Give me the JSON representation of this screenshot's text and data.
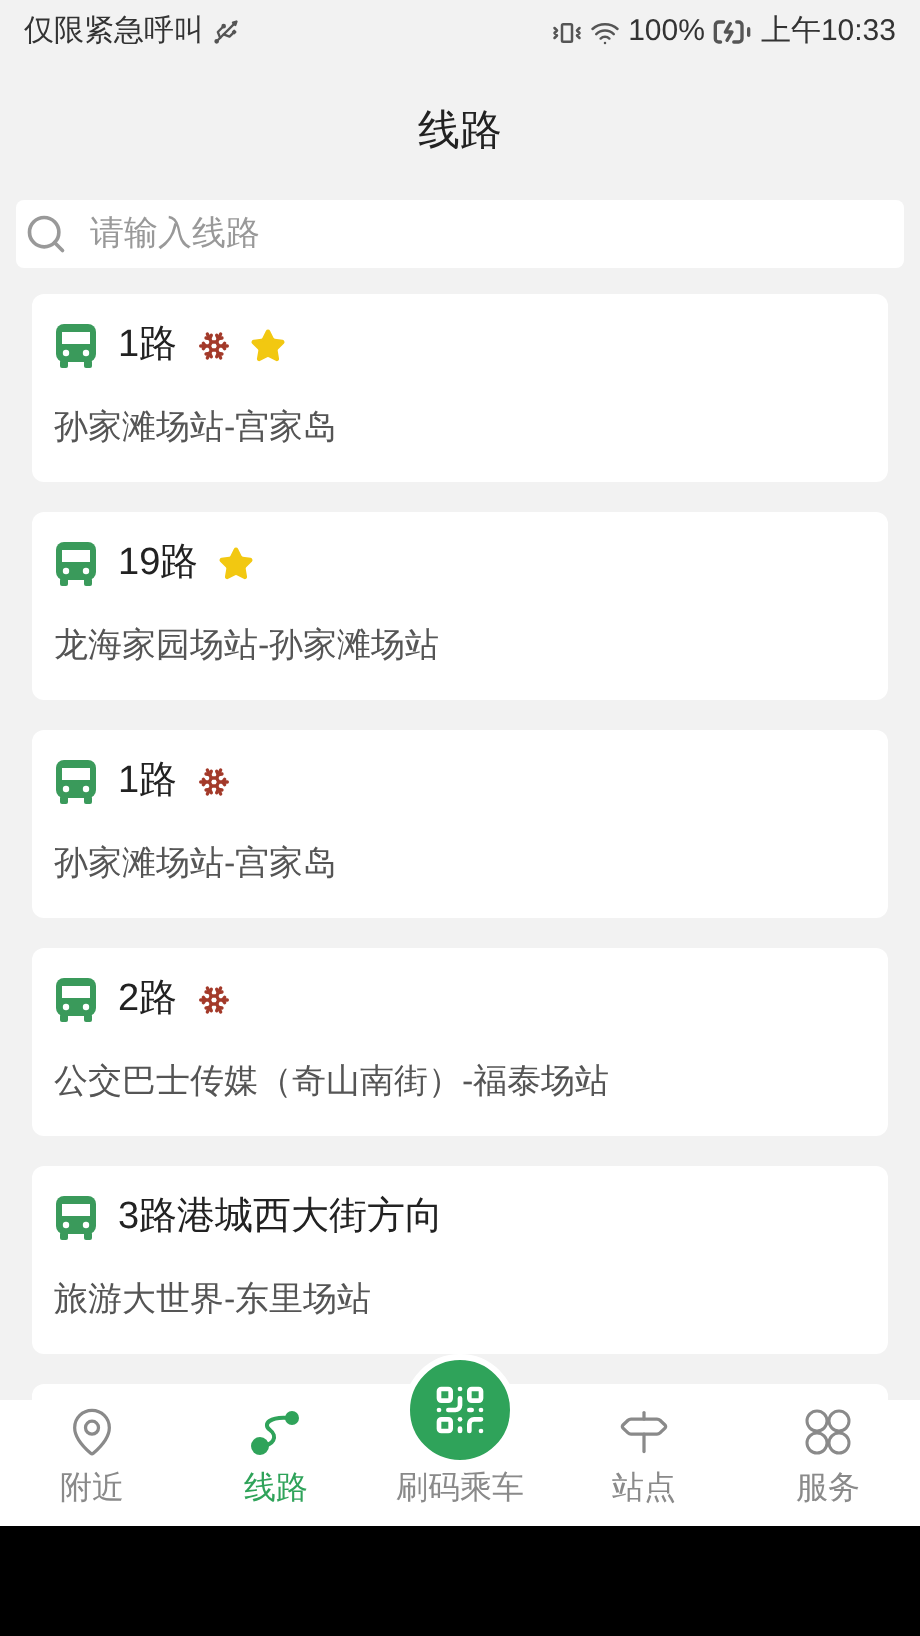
{
  "status_bar": {
    "carrier": "仅限紧急呼叫",
    "battery": "100%",
    "time": "上午10:33"
  },
  "header": {
    "title": "线路"
  },
  "search": {
    "placeholder": "请输入线路"
  },
  "routes": [
    {
      "name": "1路",
      "aircon": true,
      "favorite": true,
      "stops": "孙家滩场站-宫家岛"
    },
    {
      "name": "19路",
      "aircon": false,
      "favorite": true,
      "stops": "龙海家园场站-孙家滩场站"
    },
    {
      "name": "1路",
      "aircon": true,
      "favorite": false,
      "stops": "孙家滩场站-宫家岛"
    },
    {
      "name": "2路",
      "aircon": true,
      "favorite": false,
      "stops": "公交巴士传媒（奇山南街）-福泰场站"
    },
    {
      "name": "3路港城西大街方向",
      "aircon": false,
      "favorite": false,
      "stops": "旅游大世界-东里场站"
    }
  ],
  "tab_bar": [
    {
      "kind": "nearby",
      "label": "附近",
      "selected": false
    },
    {
      "kind": "routes",
      "label": "线路",
      "selected": true
    },
    {
      "kind": "scan",
      "label": "刷码乘车",
      "selected": false
    },
    {
      "kind": "stations",
      "label": "站点",
      "selected": false
    },
    {
      "kind": "services",
      "label": "服务",
      "selected": false
    }
  ]
}
